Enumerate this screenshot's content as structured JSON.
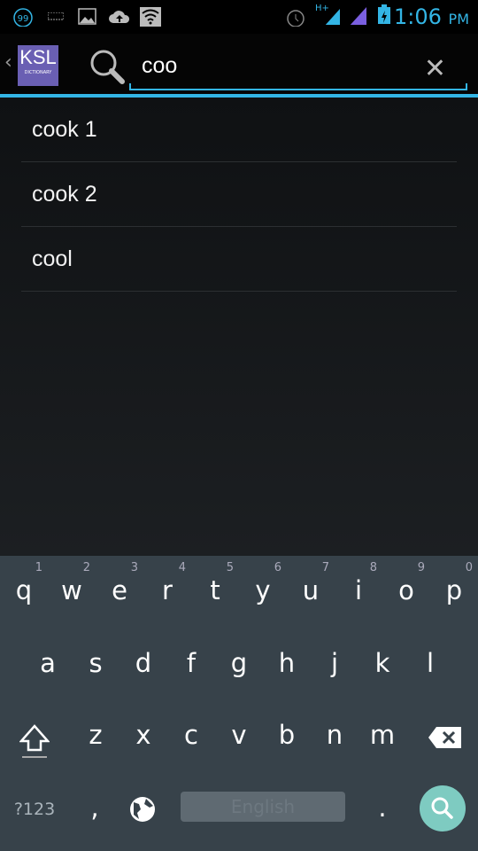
{
  "status_bar": {
    "time": "1:06",
    "ampm": "PM",
    "notification_count": "99",
    "network": "H+",
    "icons": [
      "notification-count-icon",
      "keyboard-icon",
      "image-icon",
      "cloud-upload-icon",
      "wifi-icon",
      "alarm-icon",
      "signal-icon",
      "signal-icon",
      "battery-charging-icon"
    ]
  },
  "app": {
    "logo_text": "KSL",
    "logo_subtext": "DICTIONARY"
  },
  "search": {
    "value": "coo"
  },
  "results": [
    {
      "label": "cook 1"
    },
    {
      "label": "cook 2"
    },
    {
      "label": "cool"
    }
  ],
  "keyboard": {
    "row1": [
      [
        "q",
        "1"
      ],
      [
        "w",
        "2"
      ],
      [
        "e",
        "3"
      ],
      [
        "r",
        "4"
      ],
      [
        "t",
        "5"
      ],
      [
        "y",
        "6"
      ],
      [
        "u",
        "7"
      ],
      [
        "i",
        "8"
      ],
      [
        "o",
        "9"
      ],
      [
        "p",
        "0"
      ]
    ],
    "row2": [
      "a",
      "s",
      "d",
      "f",
      "g",
      "h",
      "j",
      "k",
      "l"
    ],
    "row3": [
      "z",
      "x",
      "c",
      "v",
      "b",
      "n",
      "m"
    ],
    "symbols_label": "?123",
    "comma": ",",
    "period": ".",
    "space_label": "English",
    "accent": "#7ecbc1"
  }
}
